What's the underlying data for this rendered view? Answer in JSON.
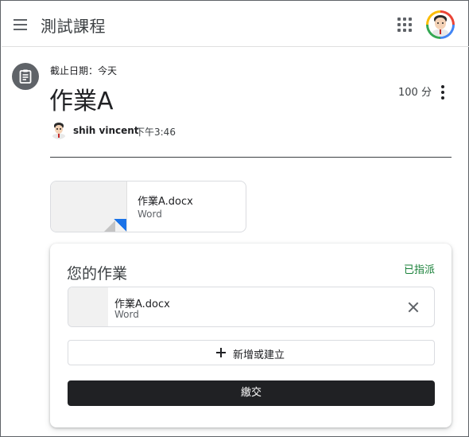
{
  "header": {
    "course_title": "測試課程",
    "menu_icon": "hamburger-menu-icon",
    "apps_icon": "google-apps-grid-icon",
    "avatar_badge": "Student"
  },
  "assignment": {
    "icon": "assignment-icon",
    "due_text": "截止日期：今天",
    "title": "作業A",
    "points": "100 分",
    "author": "shih vincent",
    "posted_time": "下午3:46",
    "attachment": {
      "name": "作業A.docx",
      "type": "Word"
    }
  },
  "your_work": {
    "title": "您的作業",
    "status": "已指派",
    "status_color": "#188038",
    "file": {
      "name": "作業A.docx",
      "type": "Word"
    },
    "add_label": "新增或建立",
    "submit_label": "繳交"
  },
  "colors": {
    "accent_blue": "#1a73e8",
    "dark_button": "#202124"
  }
}
